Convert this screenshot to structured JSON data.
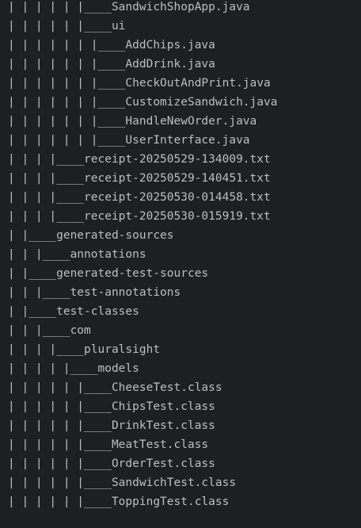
{
  "console": {
    "lines": [
      "| | | | | |____SandwichShopApp.java",
      "| | | | | |____ui",
      "| | | | | | |____AddChips.java",
      "| | | | | | |____AddDrink.java",
      "| | | | | | |____CheckOutAndPrint.java",
      "| | | | | | |____CustomizeSandwich.java",
      "| | | | | | |____HandleNewOrder.java",
      "| | | | | | |____UserInterface.java",
      "| | | |____receipt-20250529-134009.txt",
      "| | | |____receipt-20250529-140451.txt",
      "| | | |____receipt-20250530-014458.txt",
      "| | | |____receipt-20250530-015919.txt",
      "| |____generated-sources",
      "| | |____annotations",
      "| |____generated-test-sources",
      "| | |____test-annotations",
      "| |____test-classes",
      "| | |____com",
      "| | | |____pluralsight",
      "| | | | |____models",
      "| | | | | |____CheeseTest.class",
      "| | | | | |____ChipsTest.class",
      "| | | | | |____DrinkTest.class",
      "| | | | | |____MeatTest.class",
      "| | | | | |____OrderTest.class",
      "| | | | | |____SandwichTest.class",
      "| | | | | |____ToppingTest.class"
    ]
  }
}
